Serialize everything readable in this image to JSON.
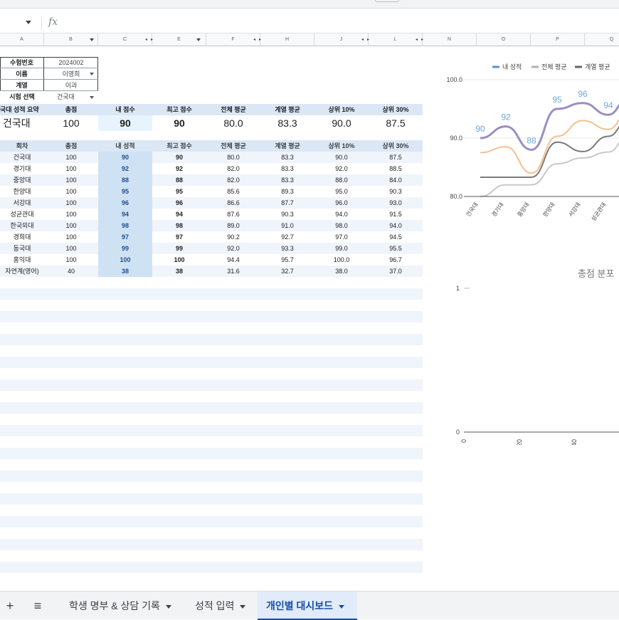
{
  "formula_bar": {
    "fx_label": "fx"
  },
  "columns": [
    "A",
    "B",
    "C",
    "",
    "E",
    "",
    "F",
    "H",
    "",
    "J",
    "",
    "L",
    "",
    "N",
    "O",
    "P",
    "Q"
  ],
  "info": {
    "rows": [
      {
        "label": "수험번호",
        "value": "2024002",
        "dropdown": false
      },
      {
        "label": "이름",
        "value": "이영희",
        "dropdown": true
      },
      {
        "label": "계열",
        "value": "이과",
        "dropdown": false
      }
    ],
    "exam_select_label": "시험 선택",
    "exam_select_value": "건국대"
  },
  "summary": {
    "title": "국대 성적 요약",
    "headers": [
      "총점",
      "내 점수",
      "최고 점수",
      "전체 평균",
      "계열 평균",
      "상위 10%",
      "상위 30%"
    ],
    "school": "건국대",
    "values": [
      "100",
      "90",
      "90",
      "80.0",
      "83.3",
      "90.0",
      "87.5"
    ]
  },
  "table": {
    "headers": [
      "회차",
      "총점",
      "내 성적",
      "최고 점수",
      "전체 평균",
      "계열 평균",
      "상위 10%",
      "상위 30%"
    ],
    "rows": [
      [
        "건국대",
        "100",
        "90",
        "90",
        "80.0",
        "83.3",
        "90.0",
        "87.5"
      ],
      [
        "경기대",
        "100",
        "92",
        "92",
        "82.0",
        "83.3",
        "92.0",
        "88.5"
      ],
      [
        "중앙대",
        "100",
        "88",
        "88",
        "82.0",
        "83.3",
        "88.0",
        "84.0"
      ],
      [
        "한양대",
        "100",
        "95",
        "95",
        "85.6",
        "89.3",
        "95.0",
        "90.3"
      ],
      [
        "서강대",
        "100",
        "96",
        "96",
        "86.6",
        "87.7",
        "96.0",
        "93.0"
      ],
      [
        "성균관대",
        "100",
        "94",
        "94",
        "87.6",
        "90.3",
        "94.0",
        "91.5"
      ],
      [
        "한국외대",
        "100",
        "98",
        "98",
        "89.0",
        "91.0",
        "98.0",
        "94.0"
      ],
      [
        "경희대",
        "100",
        "97",
        "97",
        "90.2",
        "92.7",
        "97.0",
        "94.5"
      ],
      [
        "동국대",
        "100",
        "99",
        "99",
        "92.0",
        "93.3",
        "99.0",
        "95.5"
      ],
      [
        "홍익대",
        "100",
        "100",
        "100",
        "94.4",
        "95.7",
        "100.0",
        "96.7"
      ],
      [
        "자연계(영어)",
        "40",
        "38",
        "38",
        "31.6",
        "32.7",
        "38.0",
        "37.0"
      ]
    ]
  },
  "chart_data": [
    {
      "type": "line",
      "title": "",
      "categories": [
        "건국대",
        "경기대",
        "중앙대",
        "한양대",
        "서강대",
        "성균관대"
      ],
      "series": [
        {
          "name": "내 성적",
          "values": [
            90,
            92,
            88,
            95,
            96,
            94
          ],
          "color": "#9b8ec4",
          "data_labels": true
        },
        {
          "name": "전체 평균",
          "values": [
            80.0,
            82.0,
            82.0,
            85.6,
            86.6,
            87.6
          ],
          "color": "#c8c8c8"
        },
        {
          "name": "계열 평균",
          "values": [
            83.3,
            83.3,
            83.3,
            89.3,
            87.7,
            90.3
          ],
          "color": "#7a7a7a"
        },
        {
          "name": "",
          "values": [
            87.5,
            88.5,
            84.0,
            90.3,
            93.0,
            91.5
          ],
          "color": "#f5c08f"
        }
      ],
      "y_ticks": [
        "80.0",
        "90.0",
        "100.0"
      ],
      "ylim": [
        80,
        100
      ],
      "legend_position": "top",
      "legend_colors": [
        "#5b8ed6",
        "#b0b0b0",
        "#666666"
      ]
    },
    {
      "type": "bar",
      "title": "총점 분포",
      "y_ticks": [
        "0",
        "1"
      ],
      "x_ticks": [
        "0",
        "20",
        "40"
      ],
      "values": []
    }
  ],
  "tabs": {
    "add": "+",
    "menu": "≡",
    "items": [
      {
        "label": "학생 명부 & 상담 기록"
      },
      {
        "label": "성적 입력"
      },
      {
        "label": "개인별 대시보드"
      }
    ]
  }
}
